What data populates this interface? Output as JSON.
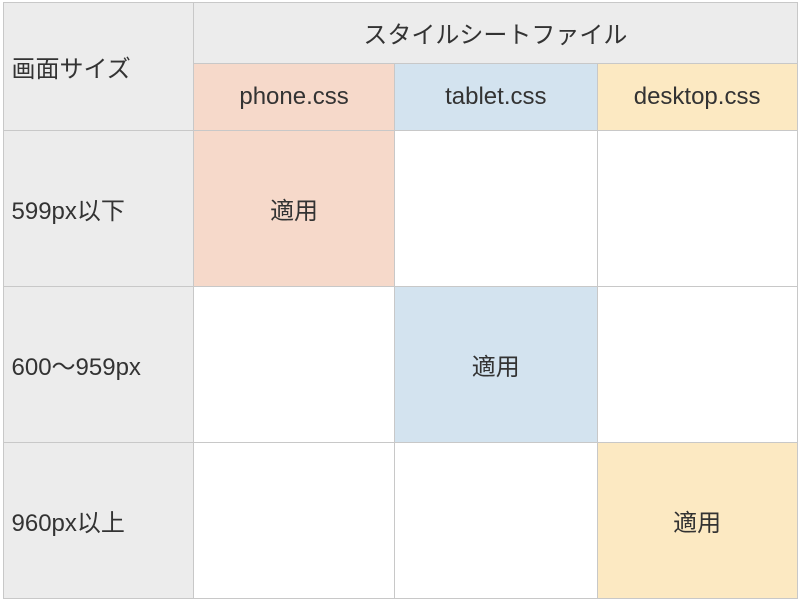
{
  "table": {
    "row_header_label": "画面サイズ",
    "group_header_label": "スタイルシートファイル",
    "columns": {
      "phone": "phone.css",
      "tablet": "tablet.css",
      "desktop": "desktop.css"
    },
    "applied_label": "適用",
    "rows": [
      {
        "label": "599px以下",
        "applied": "phone"
      },
      {
        "label": "600～959px",
        "applied": "tablet"
      },
      {
        "label": "960px以上",
        "applied": "desktop"
      }
    ]
  }
}
